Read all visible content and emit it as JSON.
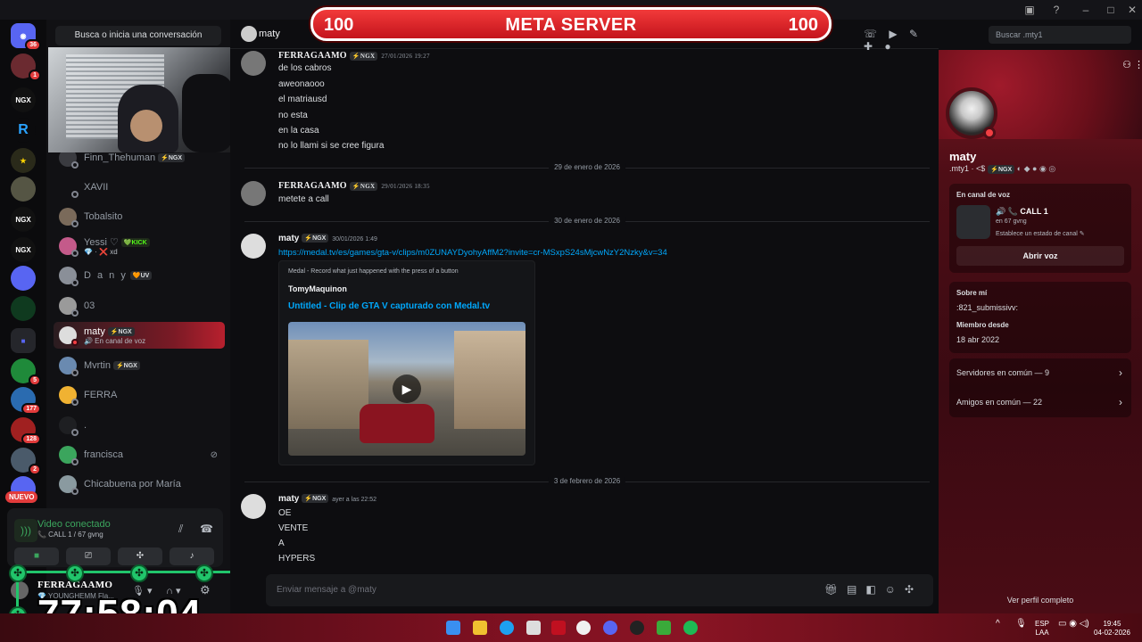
{
  "banner": {
    "title": "META SERVER",
    "left_num": "100",
    "right_num": "100"
  },
  "dm_sidebar": {
    "search_label": "Busca o inicia una conversación",
    "nuevo": "NUEVO",
    "items": [
      {
        "name": "Finn_Thehuman",
        "tag": "⚡NGX",
        "sub": ""
      },
      {
        "name": "XAVII",
        "tag": "",
        "sub": ""
      },
      {
        "name": "Tobalsito",
        "tag": "",
        "sub": ""
      },
      {
        "name": "Yessi ♡",
        "tag": "💚KICK",
        "sub": "💎 · ❌ xd"
      },
      {
        "name": "D a n y",
        "tag": "🧡UV",
        "sub": ""
      },
      {
        "name": "03",
        "tag": "",
        "sub": ""
      },
      {
        "name": "maty",
        "tag": "⚡NGX",
        "sub": "🔊 En canal de voz"
      },
      {
        "name": "Mvrtin",
        "tag": "⚡NGX",
        "sub": ""
      },
      {
        "name": "FERRA",
        "tag": "",
        "sub": ""
      },
      {
        "name": ".",
        "tag": "",
        "sub": ""
      },
      {
        "name": "francisca",
        "tag": "",
        "sub": ""
      },
      {
        "name": "Chicabuena por María",
        "tag": "",
        "sub": ""
      }
    ]
  },
  "rail_badges": {
    "home": "36",
    "s2": "1",
    "s13": "5",
    "s14": "177",
    "s15": "128",
    "s16": "2"
  },
  "voice": {
    "title": "Video conectado",
    "sub": "📞 CALL 1 / 67 gvng"
  },
  "user": {
    "name": "FERRAGAAMO",
    "sub": "💎 YOUNGHEMM Fla..."
  },
  "timer": "77:58:04",
  "chat": {
    "channel": "maty",
    "search_placeholder": "Buscar .mty1",
    "composer_placeholder": "Enviar mensaje a @maty",
    "group1": {
      "author": "FERRAGAAMO",
      "tag": "⚡NGX",
      "time": "27/01/2026 19:27",
      "lines": [
        "de los cabros",
        "aweonaooo",
        "el matriausd",
        "no esta",
        "en la casa",
        "no lo llami si se cree figura"
      ]
    },
    "divider1": "29 de enero de 2026",
    "group2": {
      "author": "FERRAGAAMO",
      "tag": "⚡NGX",
      "time": "29/01/2026 18:35",
      "lines": [
        "metete a call"
      ]
    },
    "divider2": "30 de enero de 2026",
    "group3": {
      "author": "maty",
      "tag": "⚡NGX",
      "time": "30/01/2026 1:49",
      "link": "https://medal.tv/es/games/gta-v/clips/m0ZUNAYDyohyAffM2?invite=cr-MSxpS24sMjcwNzY2Nzky&v=34"
    },
    "embed": {
      "provider": "Medal - Record what just happened with the press of a button",
      "author": "TomyMaquinon",
      "title": "Untitled - Clip de GTA V capturado con Medal.tv"
    },
    "divider3": "3 de febrero de 2026",
    "group4": {
      "author": "maty",
      "tag": "⚡NGX",
      "time": "ayer a las 22:52",
      "lines": [
        "OE",
        "VENTE",
        "A",
        "HYPERS"
      ]
    }
  },
  "profile": {
    "name": "maty",
    "username": ".mty1 · <$",
    "tag": "⚡NGX",
    "voice_label": "En canal de voz",
    "call_name": "🔊 📞 CALL 1",
    "call_server": "en 67 gvng",
    "call_status": "Establece un estado de canal ✎",
    "open_voice": "Abrir voz",
    "about_label": "Sobre mí",
    "about_value": ":821_submissivv:",
    "member_label": "Miembro desde",
    "member_value": "18 abr 2022",
    "servers_common": "Servidores en común — 9",
    "friends_common": "Amigos en común — 22",
    "view_full": "Ver perfil completo"
  },
  "taskbar": {
    "lang1": "ESP",
    "lang2": "LAA",
    "time": "19:45",
    "date": "04-02-2026"
  }
}
